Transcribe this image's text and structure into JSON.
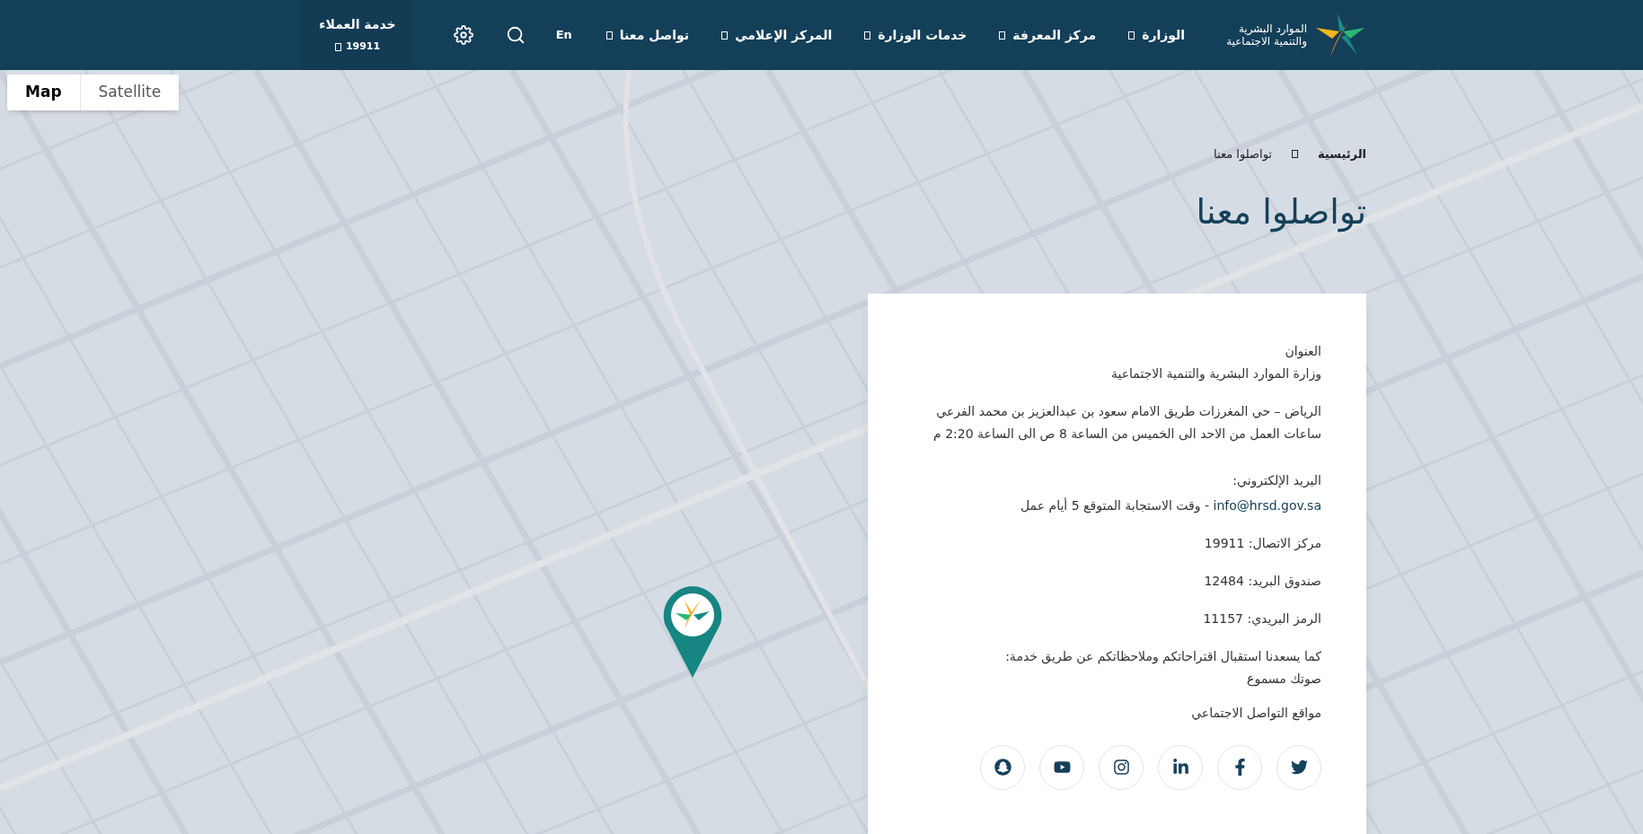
{
  "header": {
    "logo_lines": [
      "الموارد البشرية",
      "والتنمية الاجتماعية"
    ],
    "nav": [
      {
        "label": "الوزارة",
        "has_menu": true
      },
      {
        "label": "مركز المعرفة",
        "has_menu": true
      },
      {
        "label": "خدمات الوزارة",
        "has_menu": true
      },
      {
        "label": "المركز الإعلامي",
        "has_menu": true
      },
      {
        "label": "تواصل معنا",
        "has_menu": true
      }
    ],
    "language": "En",
    "customer_service": {
      "label": "خدمة العملاء",
      "number": "19911"
    }
  },
  "map": {
    "view_toggle": [
      {
        "label": "Satellite",
        "selected": false
      },
      {
        "label": "Map",
        "selected": true
      }
    ]
  },
  "breadcrumb": [
    {
      "label": "الرئيسية",
      "current": false
    },
    {
      "label": "تواصلوا معنا",
      "current": true
    }
  ],
  "title": "تواصلوا معنا",
  "contact_card": {
    "blocks": [
      {
        "kind": "text",
        "lines": [
          "العنوان",
          "وزارة الموارد البشرية والتنمية الاجتماعية"
        ]
      },
      {
        "kind": "text",
        "lines": [
          "الرياض – حي المغرزات طريق الامام سعود بن عبدالعزيز بن محمد الفرعي",
          "ساعات العمل من الاحد الى الخميس من الساعة 8 ص الى الساعة 2:20 م"
        ]
      },
      {
        "kind": "email",
        "label": "البريد الإلكتروني:",
        "email": "info@hrsd.gov.sa",
        "note": "- وقت الاستجابة المتوقع 5 أيام عمل"
      },
      {
        "kind": "text",
        "lines": [
          "مركز الاتصال: 19911"
        ]
      },
      {
        "kind": "text",
        "lines": [
          "صندوق البريد: 12484"
        ]
      },
      {
        "kind": "text",
        "lines": [
          "الرمز البريدي: 11157"
        ]
      },
      {
        "kind": "text",
        "lines": [
          "كما يسعدنا استقبال اقتراحاتكم وملاحظاتكم عن طريق خدمة:",
          "صوتك مسموع"
        ]
      }
    ],
    "social_heading": "مواقع التواصل الاجتماعي",
    "social_links": [
      {
        "kind": "twitter"
      },
      {
        "kind": "facebook"
      },
      {
        "kind": "linkedin"
      },
      {
        "kind": "instagram"
      },
      {
        "kind": "youtube"
      },
      {
        "kind": "snapchat"
      }
    ]
  }
}
